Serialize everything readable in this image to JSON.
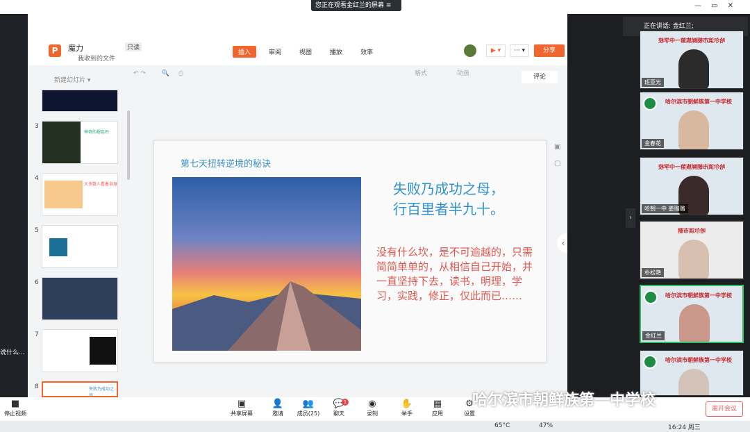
{
  "screen_share": {
    "banner": "您正在观看金红兰的屏幕",
    "window_controls": [
      "—",
      "▭",
      "✕"
    ]
  },
  "wps": {
    "doc_title": "魔力",
    "readonly": "只读",
    "doc_location": "我收到的文件",
    "menu": [
      {
        "label": "插入",
        "active": true
      },
      {
        "label": "审阅",
        "active": false
      },
      {
        "label": "视图",
        "active": false
      },
      {
        "label": "播放",
        "active": false
      },
      {
        "label": "效率",
        "active": false
      }
    ],
    "share": "分享",
    "new_slide": "新建幻灯片",
    "toolbar_right": [
      "格式",
      "动画"
    ],
    "comment": "评论",
    "thumbnails": [
      {
        "num": "",
        "text": "..."
      },
      {
        "num": "3",
        "text": "神奇的褪色石"
      },
      {
        "num": "4",
        "text": "大多数人看着自身"
      },
      {
        "num": "5",
        "text": ""
      },
      {
        "num": "6",
        "text": ""
      },
      {
        "num": "7",
        "text": ""
      },
      {
        "num": "8",
        "text": "失败乃成功之母"
      }
    ]
  },
  "slide": {
    "title": "第七天扭转逆境的秘诀",
    "headline_line1": "失败乃成功之母，",
    "headline_line2": "行百里者半九十。",
    "body": "没有什么坎，是不可逾越的，只需简简单单的，从相信自己开始，并一直坚持下去，读书，明理，学习，实践，修正，仅此而已……"
  },
  "panel": {
    "speaking": "正在讲话: 金红兰;",
    "tiles": [
      {
        "name": "班亚光",
        "banner": "哈尔滨市朝鲜族第一中学校",
        "mirrored": true
      },
      {
        "name": "金春花",
        "banner": "哈尔滨市朝鲜族第一中学校",
        "mirrored": false
      },
      {
        "name": "哈朝一中 姜璐璐",
        "banner": "哈尔滨市朝鲜族第一中学校",
        "mirrored": true
      },
      {
        "name": "朴松艳",
        "banner": "哈尔滨市朝",
        "mirrored": true
      },
      {
        "name": "金红兰",
        "banner": "哈尔滨市朝鲜族第一中学校",
        "mirrored": false
      },
      {
        "name": "",
        "banner": "哈尔滨市朝鲜族第一中学校",
        "mirrored": false
      }
    ]
  },
  "meeting_bar": {
    "stop_video": "停止视频",
    "tools": [
      {
        "label": "共享屏幕",
        "icon": "screen-share-icon"
      },
      {
        "label": "邀请",
        "icon": "invite-icon"
      },
      {
        "label": "成员(25)",
        "icon": "members-icon"
      },
      {
        "label": "聊天",
        "icon": "chat-icon"
      },
      {
        "label": "录制",
        "icon": "record-icon"
      },
      {
        "label": "举手",
        "icon": "hand-icon"
      },
      {
        "label": "应用",
        "icon": "apps-icon"
      },
      {
        "label": "设置",
        "icon": "settings-icon"
      }
    ],
    "chat_badge": "1",
    "leave": "离开会议",
    "watermark": "哈尔滨市朝鲜族第一中学校"
  },
  "taskbar": {
    "temp": "65°C",
    "battery": "47%",
    "time": "16:24 周三"
  },
  "side": {
    "text": "说什么..."
  },
  "colors": {
    "accent": "#f0662e",
    "slide_title": "#3d8fc7",
    "slide_red": "#e0574f"
  }
}
